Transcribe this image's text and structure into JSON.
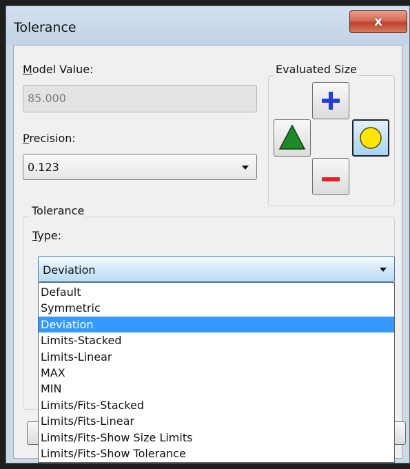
{
  "window": {
    "title": "Tolerance",
    "close_label": "x"
  },
  "model_value": {
    "label_mnemonic": "M",
    "label_rest": "odel Value:",
    "value": "85.000"
  },
  "precision": {
    "label_mnemonic": "P",
    "label_rest": "recision:",
    "value": "0.123"
  },
  "evaluated_size": {
    "label": "Evaluated Size",
    "buttons": [
      {
        "name": "upper",
        "icon": "plus-icon",
        "color": "#1f3fd6"
      },
      {
        "name": "lower",
        "icon": "minus-icon",
        "color": "#e0202a"
      },
      {
        "name": "min",
        "icon": "triangle-icon",
        "color": "#1f8a2a"
      },
      {
        "name": "nominal",
        "icon": "circle-icon",
        "color": "#ffe600",
        "selected": true
      }
    ]
  },
  "tolerance_group": {
    "label": "Tolerance",
    "type_label_mnemonic": "T",
    "type_label_rest": "ype:",
    "selected": "Deviation",
    "options": [
      "Default",
      "Symmetric",
      "Deviation",
      "Limits-Stacked",
      "Limits-Linear",
      "MAX",
      "MIN",
      "Limits/Fits-Stacked",
      "Limits/Fits-Linear",
      "Limits/Fits-Show Size Limits",
      "Limits/Fits-Show Tolerance"
    ],
    "selected_index": 2
  },
  "colors": {
    "selection": "#3399ff",
    "titlebar": "#c2d3e6",
    "close_button": "#c0412a"
  }
}
